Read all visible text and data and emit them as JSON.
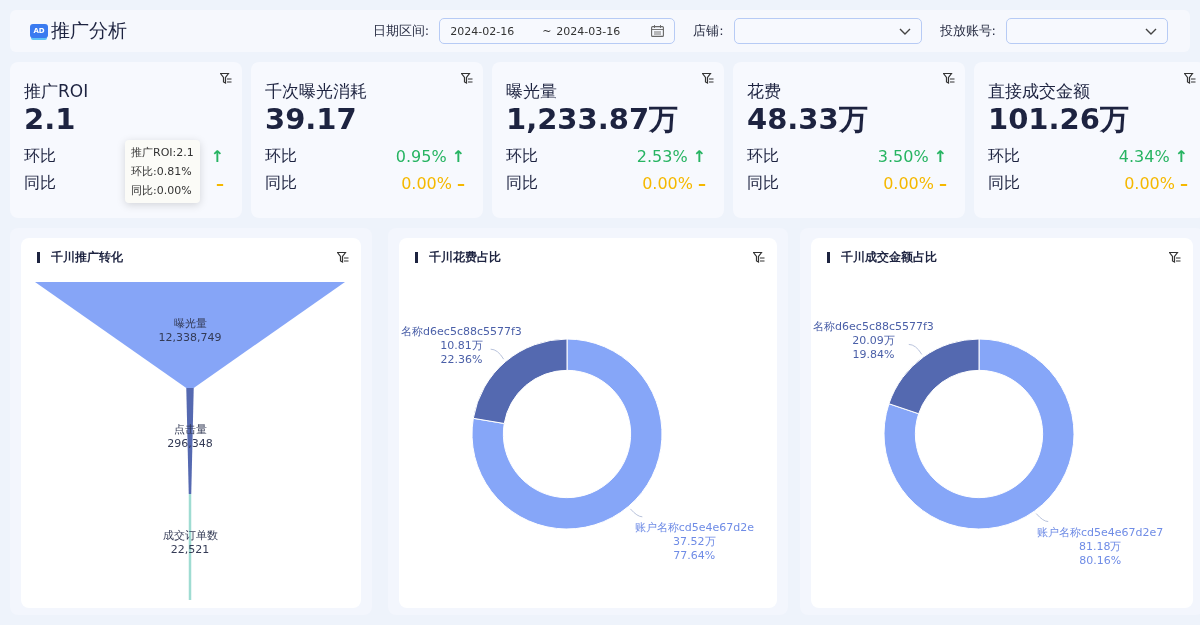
{
  "header": {
    "logo_badge": "AD",
    "title": "推广分析",
    "filters": [
      {
        "kind": "daterange",
        "label": "日期区间:",
        "start": "2024-02-16",
        "separator": "~",
        "end": "2024-03-16"
      },
      {
        "kind": "select",
        "label": "店铺:"
      },
      {
        "kind": "select",
        "label": "投放账号:"
      }
    ]
  },
  "kpis": [
    {
      "title": "推广ROI",
      "value": "2.1",
      "rows": [
        {
          "label": "环比",
          "kind": "up",
          "symbol": "↑"
        },
        {
          "label": "同比",
          "kind": "flat",
          "symbol": "–"
        }
      ],
      "tooltip": [
        "推广ROI:2.1",
        "环比:0.81%",
        "同比:0.00%"
      ]
    },
    {
      "title": "千次曝光消耗",
      "value": "39.17",
      "rows": [
        {
          "label": "环比",
          "value": "0.95%",
          "kind": "up",
          "symbol": "↑"
        },
        {
          "label": "同比",
          "value": "0.00%",
          "kind": "flat",
          "symbol": "–"
        }
      ]
    },
    {
      "title": "曝光量",
      "value": "1,233.87万",
      "rows": [
        {
          "label": "环比",
          "value": "2.53%",
          "kind": "up",
          "symbol": "↑"
        },
        {
          "label": "同比",
          "value": "0.00%",
          "kind": "flat",
          "symbol": "–"
        }
      ]
    },
    {
      "title": "花费",
      "value": "48.33万",
      "rows": [
        {
          "label": "环比",
          "value": "3.50%",
          "kind": "up",
          "symbol": "↑"
        },
        {
          "label": "同比",
          "value": "0.00%",
          "kind": "flat",
          "symbol": "–"
        }
      ]
    },
    {
      "title": "直接成交金额",
      "value": "101.26万",
      "rows": [
        {
          "label": "环比",
          "value": "4.34%",
          "kind": "up",
          "symbol": "↑"
        },
        {
          "label": "同比",
          "value": "0.00%",
          "kind": "flat",
          "symbol": "–"
        }
      ]
    }
  ],
  "panels": [
    {
      "kind": "funnel",
      "title": "千川推广转化",
      "stages": [
        {
          "label": "曝光量",
          "value": "12,338,749",
          "color": "#86a5f7"
        },
        {
          "label": "点击量",
          "value": "296,348",
          "color": "#5569b1"
        },
        {
          "label": "成交订单数",
          "value": "22,521",
          "color": "#9fdcd2"
        }
      ]
    },
    {
      "kind": "donut",
      "title": "千川花费占比",
      "chart_data": {
        "type": "donut",
        "categories": [
          "账户名称cd5e4e67d2e",
          "名称d6ec5c88c5577f3"
        ],
        "values": [
          77.64,
          22.36
        ]
      },
      "labels": [
        {
          "amount": "37.52万",
          "percent": "77.64%",
          "color": "#86a6f8"
        },
        {
          "amount": "10.81万",
          "percent": "22.36%",
          "color": "#5469b0"
        }
      ]
    },
    {
      "kind": "donut",
      "title": "千川成交金额占比",
      "chart_data": {
        "type": "donut",
        "categories": [
          "账户名称cd5e4e67d2e7",
          "名称d6ec5c88c5577f3"
        ],
        "values": [
          80.16,
          19.84
        ]
      },
      "labels": [
        {
          "amount": "81.18万",
          "percent": "80.16%",
          "color": "#86a6f8"
        },
        {
          "amount": "20.09万",
          "percent": "19.84%",
          "color": "#5469b0"
        }
      ]
    }
  ]
}
